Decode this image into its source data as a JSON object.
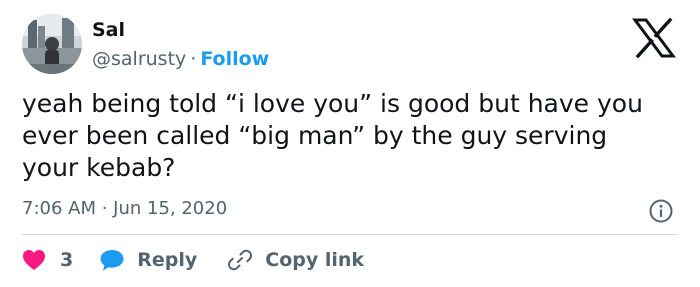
{
  "tweet": {
    "author_name": "Sal",
    "handle": "@salrusty",
    "separator": "·",
    "follow_label": "Follow",
    "text": "yeah being told “i love you” is good but have you\never been called “big man” by the guy serving\nyour kebab?",
    "timestamp": "7:06 AM · Jun 15, 2020"
  },
  "actions": {
    "like_count": "3",
    "reply_label": "Reply",
    "copy_link_label": "Copy link"
  },
  "icons": {
    "brand": "x-logo-icon",
    "info": "info-icon",
    "like": "heart-icon",
    "reply": "speech-bubble-icon",
    "copy": "link-icon"
  },
  "colors": {
    "accent": "#1d9bf0",
    "like": "#f91880",
    "muted_text": "#536471",
    "primary_text": "#0f1419",
    "divider": "#cfd9de"
  }
}
